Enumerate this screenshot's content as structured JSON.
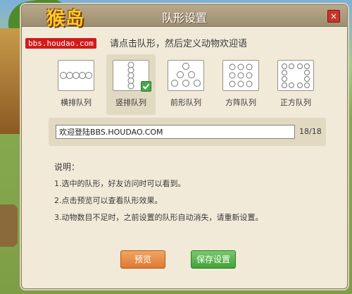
{
  "logo": {
    "text": "猴岛",
    "url": "bbs.houdao.com"
  },
  "dialog": {
    "title": "队形设置",
    "close_glyph": "×",
    "hint": "请点击队形，然后定义动物欢迎语",
    "formations": [
      {
        "label": "横排队列",
        "icon": "horizontal-line-formation-icon",
        "selected": false
      },
      {
        "label": "竖排队列",
        "icon": "vertical-line-formation-icon",
        "selected": true
      },
      {
        "label": "前形队列",
        "icon": "wedge-formation-icon",
        "selected": false
      },
      {
        "label": "方阵队列",
        "icon": "phalanx-formation-icon",
        "selected": false
      },
      {
        "label": "正方队列",
        "icon": "square-formation-icon",
        "selected": false
      }
    ],
    "greeting": {
      "value": "欢迎登陆BBS.HOUDAO.COM",
      "counter": "18/18"
    },
    "description": {
      "heading": "说明：",
      "lines": [
        "1.选中的队形，好友访问时可以看到。",
        "2.点击预览可以查看队形效果。",
        "3.动物数目不足时，之前设置的队形自动消失，请重新设置。"
      ]
    },
    "buttons": {
      "preview": "预览",
      "save": "保存设置"
    }
  },
  "colors": {
    "preview_button": "#e88a45",
    "save_button": "#55b048",
    "check": "#48a84a"
  }
}
